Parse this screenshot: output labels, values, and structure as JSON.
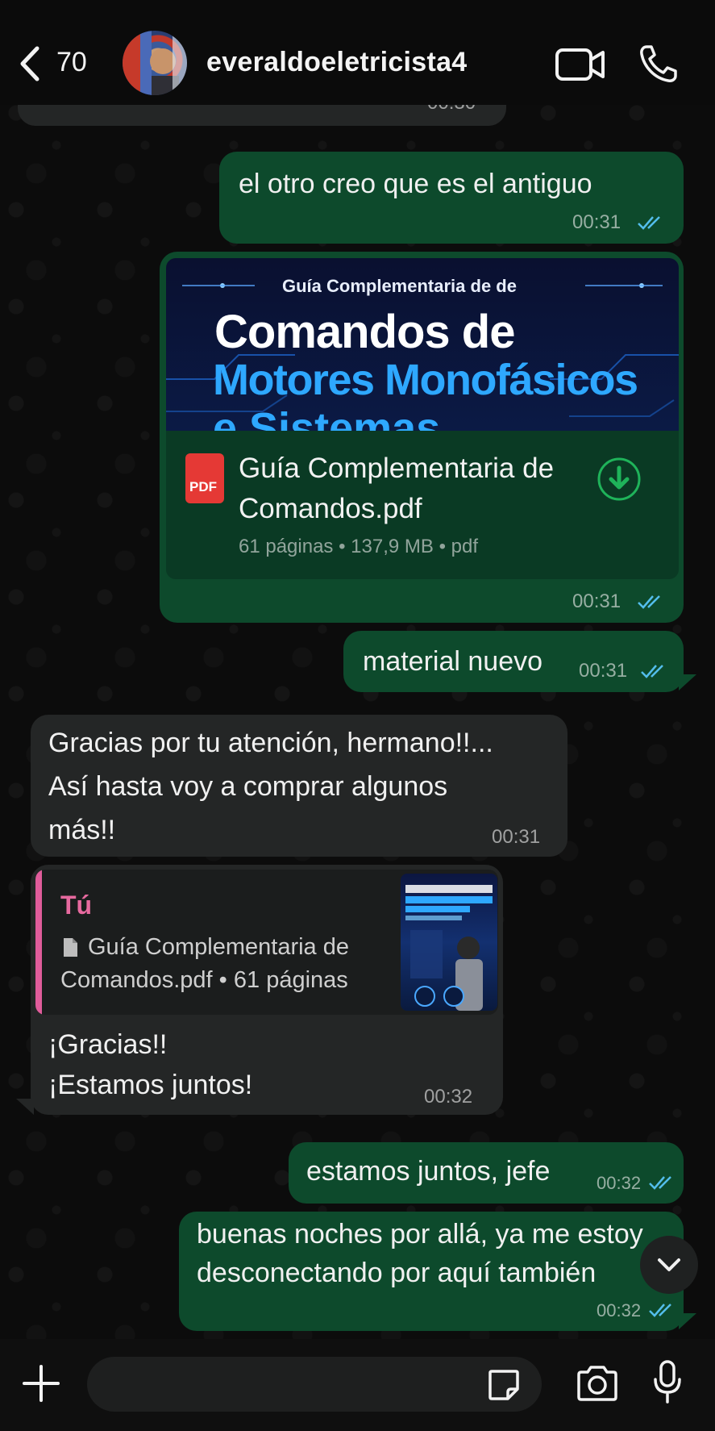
{
  "header": {
    "back_count": "70",
    "contact_name": "everaldoeletricista4"
  },
  "colors": {
    "outgoing_bubble": "#0d4a2c",
    "incoming_bubble": "#242626",
    "read_ticks": "#53bdeb",
    "quote_accent": "#e05c9b"
  },
  "messages": [
    {
      "dir": "out",
      "text": "el otro creo que es el antiguo",
      "time": "00:31",
      "status": "read"
    },
    {
      "dir": "out",
      "type": "document",
      "preview_text": {
        "line1": "Guía Complementaria de de",
        "line2": "Comandos de",
        "line3": "Motores Monofásicos",
        "line4": "e Sistemas"
      },
      "file_name": "Guía Complementaria de Comandos.pdf",
      "file_icon": "PDF",
      "meta": "61 páginas • 137,9 MB • pdf",
      "time": "00:31",
      "status": "read"
    },
    {
      "dir": "out",
      "text": "material nuevo",
      "time": "00:31",
      "status": "read"
    },
    {
      "dir": "in",
      "text": "Gracias por tu atención, hermano!!...\nAsí hasta voy a comprar algunos\nmás!!",
      "time": "00:31"
    },
    {
      "dir": "in",
      "type": "reply",
      "quote_author": "Tú",
      "quote_text": "Guía Complementaria de\nComandos.pdf • 61 páginas",
      "text": "¡Gracias!!\n¡Estamos juntos!",
      "time": "00:32"
    },
    {
      "dir": "out",
      "text": "estamos juntos, jefe",
      "time": "00:32",
      "status": "read"
    },
    {
      "dir": "out",
      "text": "buenas noches por allá, ya me estoy\ndesconectando por aquí también",
      "time": "00:32",
      "status": "read"
    }
  ],
  "composer": {
    "placeholder": ""
  },
  "icons": [
    "chevron-left-icon",
    "video-call-icon",
    "phone-icon",
    "pdf-icon",
    "download-icon",
    "file-icon",
    "chevron-down-icon",
    "plus-icon",
    "sticker-icon",
    "camera-icon",
    "microphone-icon"
  ]
}
